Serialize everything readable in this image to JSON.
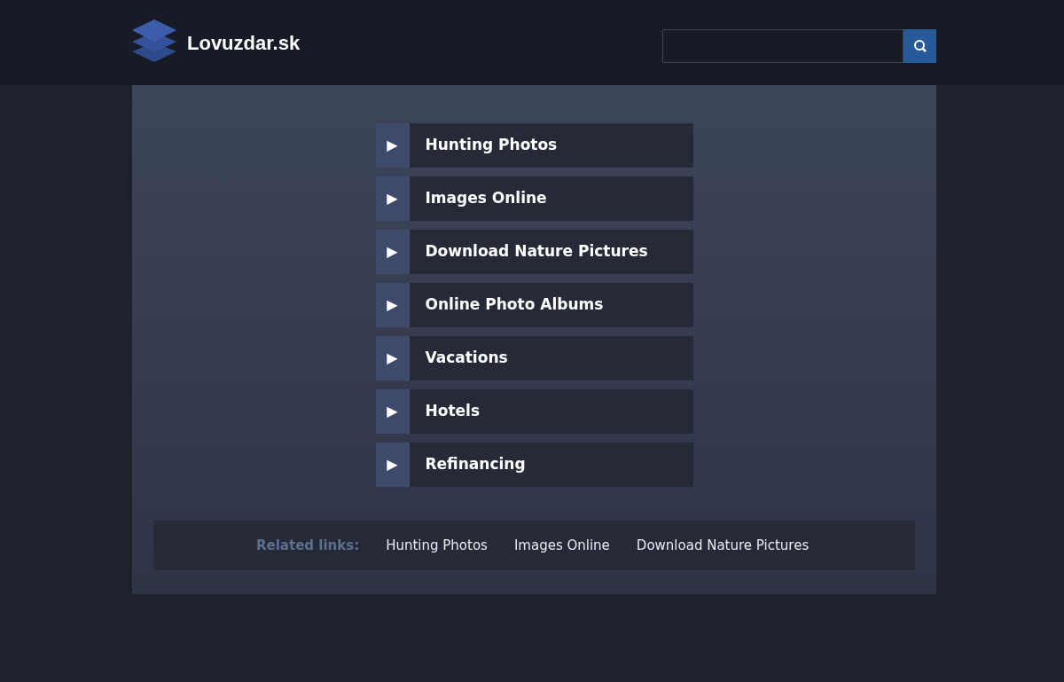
{
  "site": {
    "name": "Lovuzdar.sk"
  },
  "links": [
    {
      "label": "Hunting Photos",
      "icon": "▶"
    },
    {
      "label": "Images Online",
      "icon": "▶"
    },
    {
      "label": "Download Nature Pictures",
      "icon": "▶"
    },
    {
      "label": "Online Photo Albums",
      "icon": "▶"
    },
    {
      "label": "Vacations",
      "icon": "▶"
    },
    {
      "label": "Hotels",
      "icon": "▶"
    },
    {
      "label": "Refinancing",
      "icon": "▶"
    }
  ],
  "related": {
    "heading": "Related links:",
    "links": [
      "Hunting Photos",
      "Images Online",
      "Download Nature Pictures"
    ]
  }
}
